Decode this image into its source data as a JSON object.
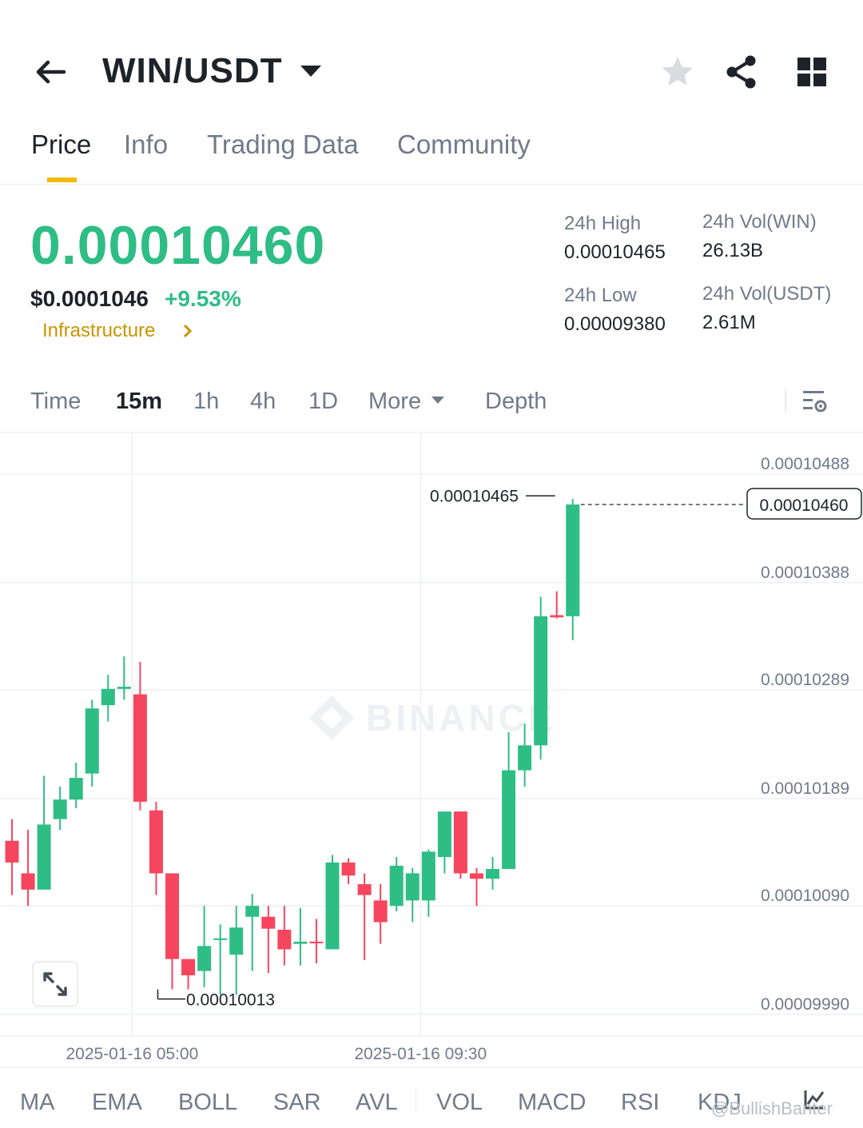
{
  "header": {
    "pair": "WIN/USDT",
    "icons": [
      "arrow-left-icon",
      "caret-down-icon",
      "star-icon",
      "share-icon",
      "grid-icon"
    ]
  },
  "tabs": [
    {
      "label": "Price",
      "active": true
    },
    {
      "label": "Info",
      "active": false
    },
    {
      "label": "Trading Data",
      "active": false
    },
    {
      "label": "Community",
      "active": false
    }
  ],
  "price": {
    "last": "0.00010460",
    "usd": "$0.0001046",
    "change": "+9.53%",
    "category": "Infrastructure"
  },
  "stats": {
    "high_label": "24h High",
    "high_value": "0.00010465",
    "low_label": "24h Low",
    "low_value": "0.00009380",
    "vol_win_label": "24h Vol(WIN)",
    "vol_win_value": "26.13B",
    "vol_usdt_label": "24h Vol(USDT)",
    "vol_usdt_value": "2.61M"
  },
  "intervals": {
    "items": [
      {
        "label": "Time",
        "active": false
      },
      {
        "label": "15m",
        "active": true
      },
      {
        "label": "1h",
        "active": false
      },
      {
        "label": "4h",
        "active": false
      },
      {
        "label": "1D",
        "active": false
      },
      {
        "label": "More",
        "active": false
      },
      {
        "label": "Depth",
        "active": false
      }
    ]
  },
  "chart_data": {
    "type": "candlestick",
    "watermark": "BINANCE",
    "y_ticks": [
      "0.00010488",
      "0.00010388",
      "0.00010289",
      "0.00010189",
      "0.00010090",
      "0.00009990"
    ],
    "y_tick_values": [
      0.00010488,
      0.00010388,
      0.00010289,
      0.00010189,
      0.0001009,
      9.99e-05
    ],
    "x_ticks": [
      "2025-01-16 05:00",
      "2025-01-16 09:30"
    ],
    "x_tick_index": [
      7.5,
      25.5
    ],
    "last_price_label": "0.00010460",
    "last_price_value": 0.0001046,
    "high_label": "0.00010465",
    "high_value": 0.00010465,
    "high_index": 34,
    "low_label": "0.00010013",
    "low_value": 0.00010013,
    "low_index": 9,
    "ylim": [
      9.97e-05,
      0.00010505
    ],
    "candles": [
      {
        "o": 0.0001015,
        "h": 0.0001017,
        "l": 0.000101,
        "c": 0.0001013
      },
      {
        "o": 0.0001012,
        "h": 0.0001016,
        "l": 0.0001009,
        "c": 0.00010105
      },
      {
        "o": 0.00010105,
        "h": 0.0001021,
        "l": 0.00010105,
        "c": 0.00010165
      },
      {
        "o": 0.0001017,
        "h": 0.000102,
        "l": 0.0001016,
        "c": 0.00010188
      },
      {
        "o": 0.00010188,
        "h": 0.00010222,
        "l": 0.0001018,
        "c": 0.00010208
      },
      {
        "o": 0.00010212,
        "h": 0.0001028,
        "l": 0.000102,
        "c": 0.00010272
      },
      {
        "o": 0.00010275,
        "h": 0.00010303,
        "l": 0.0001026,
        "c": 0.0001029
      },
      {
        "o": 0.0001029,
        "h": 0.0001032,
        "l": 0.0001028,
        "c": 0.00010292
      },
      {
        "o": 0.00010285,
        "h": 0.00010315,
        "l": 0.00010178,
        "c": 0.00010186
      },
      {
        "o": 0.00010178,
        "h": 0.00010186,
        "l": 0.000101,
        "c": 0.0001012
      },
      {
        "o": 0.0001012,
        "h": 0.0001012,
        "l": 0.00010013,
        "c": 0.00010041
      },
      {
        "o": 0.00010041,
        "h": 0.00010041,
        "l": 0.00010013,
        "c": 0.00010026
      },
      {
        "o": 0.0001003,
        "h": 0.0001009,
        "l": 0.00010015,
        "c": 0.00010053
      },
      {
        "o": 0.0001006,
        "h": 0.00010073,
        "l": 0.00010008,
        "c": 0.0001006
      },
      {
        "o": 0.00010045,
        "h": 0.0001009,
        "l": 0.00010008,
        "c": 0.0001007
      },
      {
        "o": 0.0001008,
        "h": 0.00010101,
        "l": 0.0001003,
        "c": 0.0001009
      },
      {
        "o": 0.0001008,
        "h": 0.0001009,
        "l": 0.00010028,
        "c": 0.00010069
      },
      {
        "o": 0.00010068,
        "h": 0.0001009,
        "l": 0.00010035,
        "c": 0.0001005
      },
      {
        "o": 0.00010055,
        "h": 0.00010088,
        "l": 0.00010035,
        "c": 0.00010057
      },
      {
        "o": 0.00010057,
        "h": 0.00010078,
        "l": 0.00010037,
        "c": 0.00010056
      },
      {
        "o": 0.0001005,
        "h": 0.00010137,
        "l": 0.0001005,
        "c": 0.0001013
      },
      {
        "o": 0.0001013,
        "h": 0.00010134,
        "l": 0.0001011,
        "c": 0.00010118
      },
      {
        "o": 0.0001011,
        "h": 0.0001012,
        "l": 0.0001004,
        "c": 0.000101
      },
      {
        "o": 0.00010095,
        "h": 0.0001011,
        "l": 0.00010055,
        "c": 0.00010075
      },
      {
        "o": 0.0001009,
        "h": 0.00010135,
        "l": 0.00010085,
        "c": 0.00010127
      },
      {
        "o": 0.00010095,
        "h": 0.00010125,
        "l": 0.00010075,
        "c": 0.0001012
      },
      {
        "o": 0.00010095,
        "h": 0.00010142,
        "l": 0.0001008,
        "c": 0.0001014
      },
      {
        "o": 0.00010135,
        "h": 0.00010177,
        "l": 0.0001012,
        "c": 0.00010177
      },
      {
        "o": 0.00010177,
        "h": 0.00010177,
        "l": 0.00010115,
        "c": 0.0001012
      },
      {
        "o": 0.0001012,
        "h": 0.00010125,
        "l": 0.0001009,
        "c": 0.00010115
      },
      {
        "o": 0.00010115,
        "h": 0.00010135,
        "l": 0.00010105,
        "c": 0.00010124
      },
      {
        "o": 0.00010124,
        "h": 0.0001025,
        "l": 0.00010124,
        "c": 0.00010215
      },
      {
        "o": 0.00010215,
        "h": 0.00010258,
        "l": 0.000102,
        "c": 0.00010238
      },
      {
        "o": 0.00010238,
        "h": 0.00010375,
        "l": 0.00010225,
        "c": 0.00010357
      },
      {
        "o": 0.00010358,
        "h": 0.0001038,
        "l": 0.00010355,
        "c": 0.00010356
      },
      {
        "o": 0.00010357,
        "h": 0.00010465,
        "l": 0.00010335,
        "c": 0.0001046
      }
    ],
    "up_color": "#2ebd85",
    "down_color": "#f6465d",
    "grid": true
  },
  "indicators": [
    "MA",
    "EMA",
    "BOLL",
    "SAR",
    "AVL",
    "VOL",
    "MACD",
    "RSI",
    "KDJ"
  ],
  "credit": "@BullishBanter"
}
